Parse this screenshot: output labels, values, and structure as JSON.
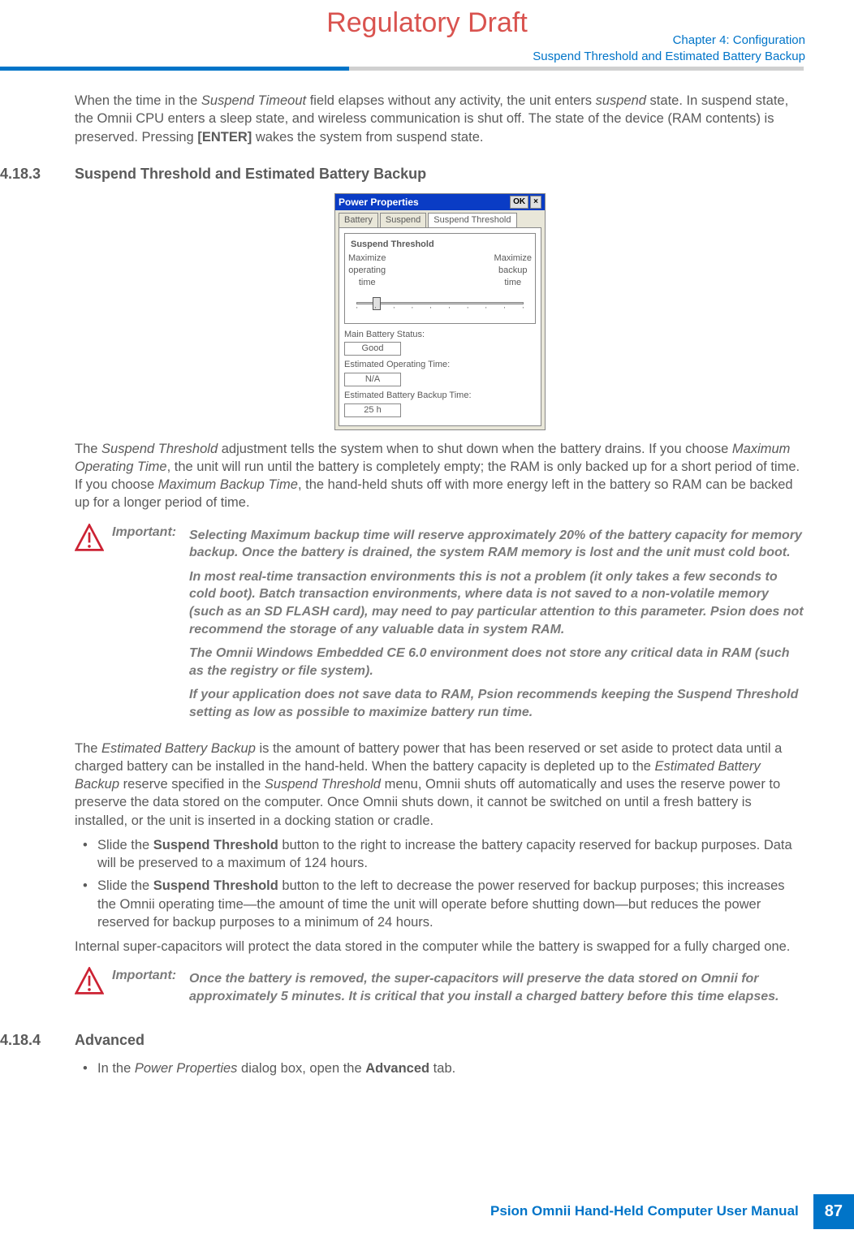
{
  "watermark": "Regulatory Draft",
  "header": {
    "chapter": "Chapter 4:  Configuration",
    "section": "Suspend Threshold and Estimated Battery Backup"
  },
  "intro_para": {
    "p1a": "When the time in the ",
    "p1b": "Suspend Timeout",
    "p1c": " field elapses without any activity, the unit enters ",
    "p1d": "suspend",
    "p1e": " state. In suspend state, the Omnii CPU enters a sleep state, and wireless communication is shut off. The state of the device (RAM contents) is preserved. Pressing ",
    "p1f": "[ENTER]",
    "p1g": " wakes the system from suspend state."
  },
  "section_4183": {
    "num": "4.18.3",
    "title": "Suspend Threshold and Estimated Battery Backup"
  },
  "screenshot": {
    "title": "Power Properties",
    "ok": "OK",
    "close": "×",
    "tabs": [
      "Battery",
      "Suspend",
      "Suspend Threshold"
    ],
    "fieldset": "Suspend Threshold",
    "left_label1": "Maximize",
    "left_label2": "operating",
    "left_label3": "time",
    "right_label1": "Maximize",
    "right_label2": "backup",
    "right_label3": "time",
    "main_status_label": "Main Battery Status:",
    "main_status_value": "Good",
    "eot_label": "Estimated Operating Time:",
    "eot_value": "N/A",
    "ebbt_label": "Estimated Battery Backup Time:",
    "ebbt_value": "25 h"
  },
  "chart_data": {
    "type": "table",
    "title": "Power Properties – Suspend Threshold",
    "rows": [
      {
        "label": "Main Battery Status",
        "value": "Good"
      },
      {
        "label": "Estimated Operating Time",
        "value": "N/A"
      },
      {
        "label": "Estimated Battery Backup Time",
        "value": "25 h"
      }
    ],
    "slider": {
      "min_label": "Maximize operating time",
      "max_label": "Maximize backup time",
      "position_index": 1,
      "tick_count": 10
    }
  },
  "para2": {
    "a": "The ",
    "b": "Suspend Threshold",
    "c": " adjustment tells the system when to shut down when the battery drains. If you choose ",
    "d": "Maximum Operating Time",
    "e": ", the unit will run until the battery is completely empty; the RAM is only backed up for a short period of time. If you choose ",
    "f": "Maximum Backup Time",
    "g": ", the hand-held shuts off with more energy left in the battery so RAM can be backed up for a longer period of time."
  },
  "important1": {
    "label": "Important:",
    "p1": "Selecting Maximum backup time will reserve approximately 20% of the battery capacity for memory backup. Once the battery is drained, the system RAM memory is lost and the unit must cold boot.",
    "p2": "In most real-time transaction environments this is not a problem (it only takes a few seconds to cold boot). Batch transaction environments, where data is not saved to a non-volatile memory (such as an SD FLASH card), may need to pay particular attention to this parameter. Psion does not recommend the storage of any valuable data in system RAM.",
    "p3": "The Omnii Windows Embedded CE 6.0 environment does not store any critical data in RAM (such as the registry or file system).",
    "p4": "If your application does not save data to RAM, Psion recommends keeping the Suspend Threshold setting as low as possible to maximize battery run time."
  },
  "para3": {
    "a": "The ",
    "b": "Estimated Battery Backup",
    "c": " is the amount of battery power that has been reserved or set aside to protect data until a charged battery can be installed in the hand-held. When the battery capacity is depleted up to the ",
    "d": "Estimated Battery Backup",
    "e": " reserve specified in the ",
    "f": "Suspend Threshold",
    "g": " menu, Omnii shuts off automatically and uses the reserve power to preserve the data stored on the computer. Once Omnii shuts down, it cannot be switched on until a fresh battery is installed, or the unit is inserted in a docking station or cradle."
  },
  "bullets": {
    "b1a": "Slide the ",
    "b1b": "Suspend Threshold",
    "b1c": " button to the right to increase the battery capacity reserved for backup purposes. Data will be preserved to a maximum of 124 hours.",
    "b2a": "Slide the ",
    "b2b": "Suspend Threshold",
    "b2c": " button to the left to decrease the power reserved for backup purposes; this increases the Omnii operating time—the amount of time the unit will operate before shutting down—but reduces the power reserved for backup purposes to a minimum of 24 hours."
  },
  "para4": "Internal super-capacitors will protect the data stored in the computer while the battery is swapped for a fully charged one.",
  "important2": {
    "label": "Important:",
    "text": "Once the battery is removed, the super-capacitors will preserve the data stored on Omnii for approximately 5 minutes. It is critical that you install a charged battery before this time elapses."
  },
  "section_4184": {
    "num": "4.18.4",
    "title": "Advanced"
  },
  "bullet_adv": {
    "a": "In the ",
    "b": "Power Properties",
    "c": " dialog box, open the ",
    "d": "Advanced",
    "e": " tab."
  },
  "footer": {
    "text": "Psion Omnii Hand-Held Computer User Manual",
    "page": "87"
  }
}
